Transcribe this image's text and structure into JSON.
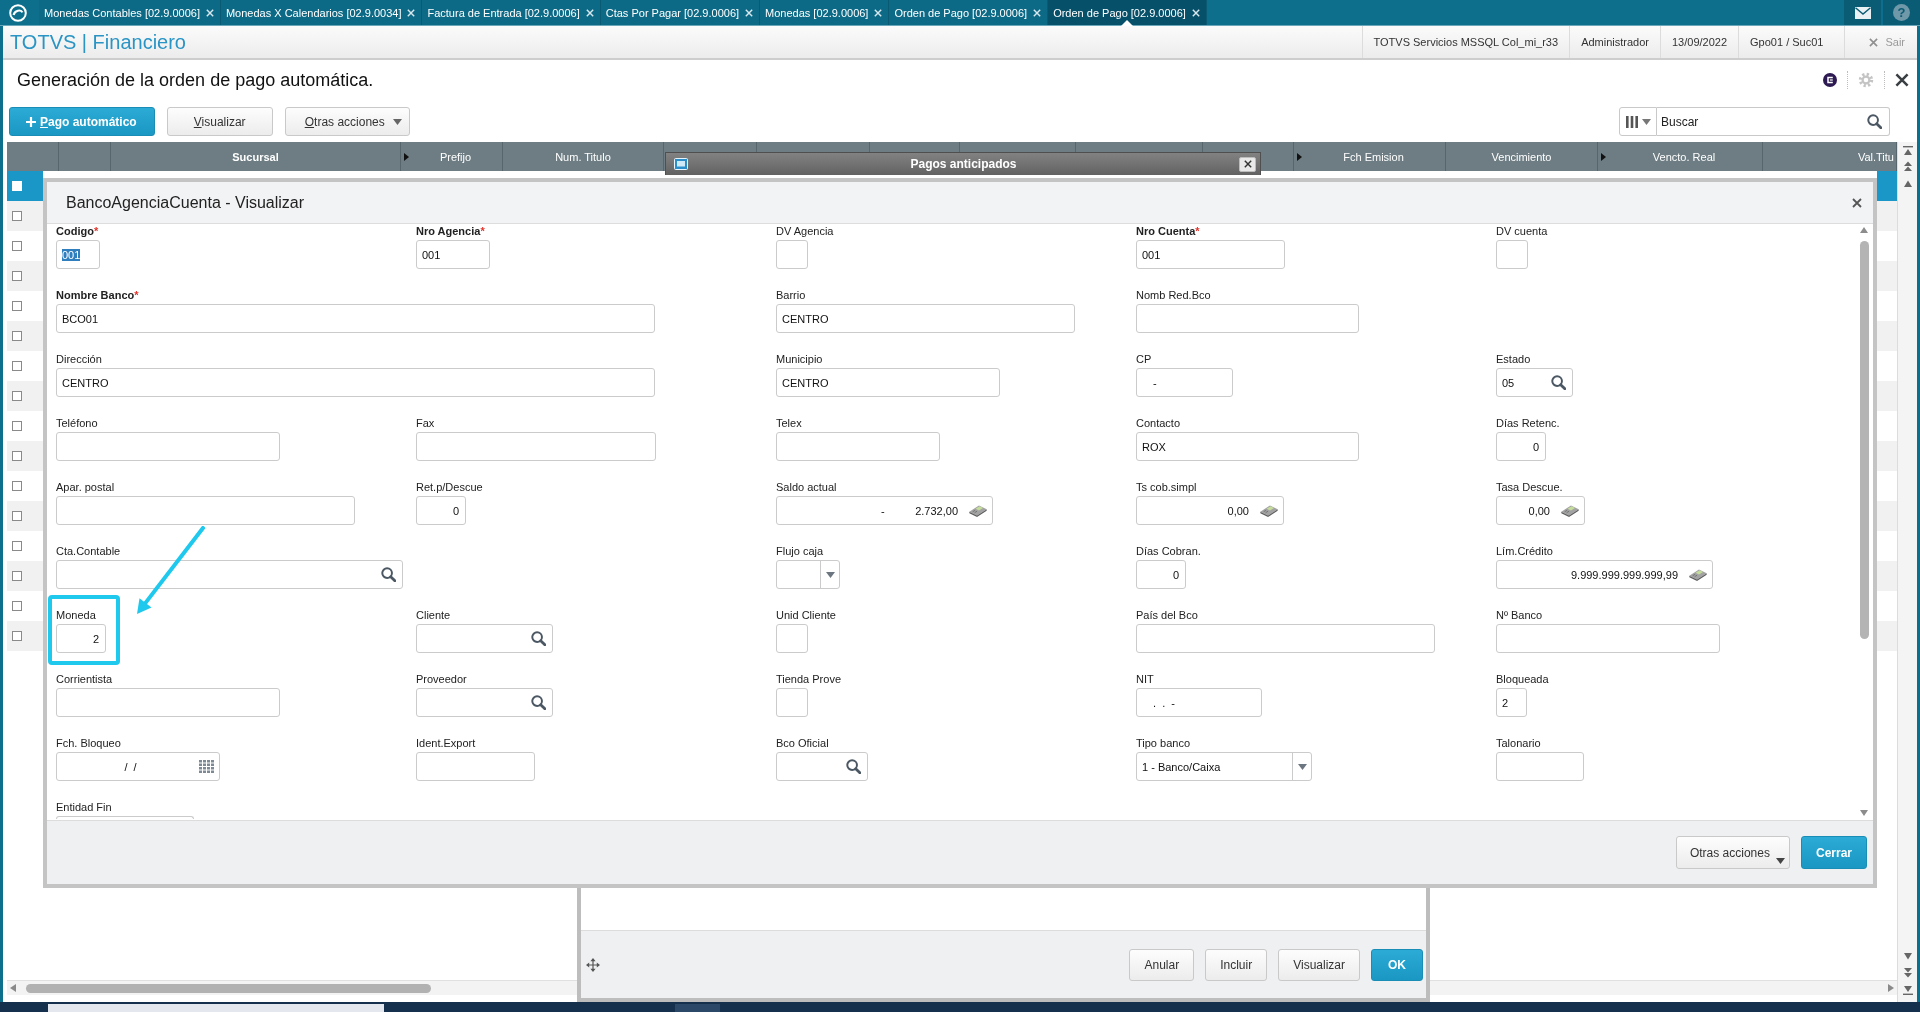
{
  "tab_bar": {
    "tabs": [
      {
        "label": "Monedas Contables [02.9.0006]",
        "selected": false
      },
      {
        "label": "Monedas X Calendarios [02.9.0034]",
        "selected": false
      },
      {
        "label": "Factura de Entrada [02.9.0006]",
        "selected": false
      },
      {
        "label": "Ctas Por Pagar [02.9.0006]",
        "selected": false
      },
      {
        "label": "Monedas [02.9.0006]",
        "selected": false
      },
      {
        "label": "Orden de Pago [02.9.0006]",
        "selected": false
      },
      {
        "label": "Orden de Pago [02.9.0006]",
        "selected": true
      }
    ],
    "help": "?"
  },
  "header": {
    "brand": "TOTVS | Financiero",
    "info": [
      "TOTVS Servicios MSSQL Col_mi_r33",
      "Administrador",
      "13/09/2022",
      "Gpo01 / Suc01"
    ],
    "exit": "Sair"
  },
  "page": {
    "title": "Generación de la orden de pago automática."
  },
  "toolbar": {
    "buttons": [
      {
        "label": "Pago automático",
        "kind": "primary"
      },
      {
        "label": "Visualizar",
        "kind": "plain"
      },
      {
        "label": "Otras acciones",
        "kind": "menu"
      }
    ],
    "search": {
      "placeholder": "Buscar"
    }
  },
  "table": {
    "columns": [
      {
        "label": "Sucursal",
        "marker": false,
        "sorted": true
      },
      {
        "label": "Prefijo",
        "marker": true,
        "sorted": false
      },
      {
        "label": "Num. Titulo",
        "marker": false,
        "sorted": false
      },
      {
        "label": "Fch Emision",
        "marker": true,
        "sorted": false
      },
      {
        "label": "Vencimiento",
        "marker": false,
        "sorted": false
      },
      {
        "label": "Vencto. Real",
        "marker": true,
        "sorted": false
      },
      {
        "label": "Val.Titu",
        "marker": false,
        "sorted": false
      }
    ],
    "rows": [
      {
        "selected": true,
        "checked": false
      },
      {
        "selected": false,
        "checked": false
      },
      {
        "selected": false,
        "checked": false
      },
      {
        "selected": false,
        "checked": false
      },
      {
        "selected": false,
        "checked": false
      },
      {
        "selected": false,
        "checked": false
      },
      {
        "selected": false,
        "checked": false
      },
      {
        "selected": false,
        "checked": false
      },
      {
        "selected": false,
        "checked": false
      },
      {
        "selected": false,
        "checked": false
      },
      {
        "selected": false,
        "checked": false
      },
      {
        "selected": false,
        "checked": false
      },
      {
        "selected": false,
        "checked": false
      },
      {
        "selected": false,
        "checked": false
      },
      {
        "selected": false,
        "checked": false
      },
      {
        "selected": false,
        "checked": false
      }
    ]
  },
  "background_dialog": {
    "title": "Pagos anticipados",
    "buttons": [
      {
        "label": "Anular",
        "kind": "plain"
      },
      {
        "label": "Incluir",
        "kind": "plain"
      },
      {
        "label": "Visualizar",
        "kind": "plain"
      },
      {
        "label": "OK",
        "kind": "primary"
      }
    ]
  },
  "dialog": {
    "title": "BancoAgenciaCuenta - Visualizar",
    "rows": [
      {
        "fields": [
          {
            "label": "Codigo",
            "required": true,
            "required_mark": "*",
            "kind": "text",
            "value": "001",
            "focused": true
          },
          {
            "label": "Nro Agencia",
            "required": true,
            "required_mark": "*",
            "kind": "text",
            "value": "001",
            "focused": false
          },
          {
            "label": "DV Agencia",
            "required": false,
            "kind": "text",
            "focused": false
          },
          {
            "label": "Nro Cuenta",
            "required": true,
            "required_mark": "*",
            "kind": "text",
            "value": "001",
            "focused": false
          },
          {
            "label": "DV cuenta",
            "required": false,
            "kind": "text",
            "focused": false
          }
        ]
      },
      {
        "fields": [
          {
            "label": "Nombre Banco",
            "required": true,
            "required_mark": "*",
            "kind": "text",
            "value": "BCO01",
            "focused": false
          },
          {
            "label": "Barrio",
            "required": false,
            "kind": "text",
            "value": "CENTRO",
            "focused": false
          },
          {
            "label": "Nomb Red.Bco",
            "required": false,
            "kind": "text",
            "focused": false
          }
        ]
      },
      {
        "fields": [
          {
            "label": "Dirección",
            "required": false,
            "kind": "text",
            "value": "CENTRO",
            "focused": false
          },
          {
            "label": "Municipio",
            "required": false,
            "kind": "text",
            "value": "CENTRO",
            "focused": false
          },
          {
            "label": "CP",
            "required": false,
            "kind": "masked",
            "value": "-",
            "focused": false
          },
          {
            "label": "Estado",
            "required": false,
            "kind": "search",
            "value": "05",
            "focused": false
          }
        ]
      },
      {
        "fields": [
          {
            "label": "Teléfono",
            "required": false,
            "kind": "text",
            "focused": false
          },
          {
            "label": "Fax",
            "required": false,
            "kind": "text",
            "focused": false
          },
          {
            "label": "Telex",
            "required": false,
            "kind": "text",
            "focused": false
          },
          {
            "label": "Contacto",
            "required": false,
            "kind": "text",
            "value": "ROX",
            "focused": false
          },
          {
            "label": "Días Retenc.",
            "required": false,
            "kind": "number",
            "value": "0",
            "focused": false
          }
        ]
      },
      {
        "fields": [
          {
            "label": "Apar. postal",
            "required": false,
            "kind": "text",
            "focused": false
          },
          {
            "label": "Ret.p/Descue",
            "required": false,
            "kind": "number",
            "value": "0",
            "focused": false
          },
          {
            "label": "Saldo actual",
            "required": false,
            "kind": "money",
            "value": "-          2.732,00",
            "focused": false
          },
          {
            "label": "Ts cob.simpl",
            "required": false,
            "kind": "money",
            "value": "0,00",
            "focused": false
          },
          {
            "label": "Tasa Descue.",
            "required": false,
            "kind": "money",
            "value": "0,00",
            "focused": false
          }
        ]
      },
      {
        "fields": [
          {
            "label": "Cta.Contable",
            "required": false,
            "kind": "search",
            "focused": false
          },
          {
            "label": "Flujo caja",
            "required": false,
            "kind": "select",
            "focused": false
          },
          {
            "label": "Días Cobran.",
            "required": false,
            "kind": "number",
            "value": "0",
            "focused": false
          },
          {
            "label": "Lím.Crédito",
            "required": false,
            "kind": "money",
            "value": "9.999.999.999.999,99",
            "focused": false
          }
        ]
      },
      {
        "fields": [
          {
            "label": "Moneda",
            "required": false,
            "kind": "number",
            "value": "2",
            "focused": false
          },
          {
            "label": "Cliente",
            "required": false,
            "kind": "search",
            "focused": false
          },
          {
            "label": "Unid Cliente",
            "required": false,
            "kind": "text",
            "focused": false
          },
          {
            "label": "País del Bco",
            "required": false,
            "kind": "text",
            "focused": false
          },
          {
            "label": "Nº Banco",
            "required": false,
            "kind": "text",
            "focused": false
          }
        ]
      },
      {
        "fields": [
          {
            "label": "Corrientista",
            "required": false,
            "kind": "text",
            "focused": false
          },
          {
            "label": "Proveedor",
            "required": false,
            "kind": "search",
            "focused": false
          },
          {
            "label": "Tienda Prove",
            "required": false,
            "kind": "text",
            "focused": false
          },
          {
            "label": "NIT",
            "required": false,
            "kind": "masked",
            "value": ".  .  -",
            "focused": false
          },
          {
            "label": "Bloqueada",
            "required": false,
            "kind": "text",
            "value": "2",
            "focused": false
          }
        ]
      },
      {
        "fields": [
          {
            "label": "Fch. Bloqueo",
            "required": false,
            "kind": "date",
            "value": "/  /",
            "focused": false
          },
          {
            "label": "Ident.Export",
            "required": false,
            "kind": "text",
            "focused": false
          },
          {
            "label": "Bco Oficial",
            "required": false,
            "kind": "search",
            "focused": false
          },
          {
            "label": "Tipo banco",
            "required": false,
            "kind": "select",
            "value": "1 - Banco/Caixa",
            "focused": false
          },
          {
            "label": "Talonario",
            "required": false,
            "kind": "text",
            "focused": false
          }
        ]
      },
      {
        "fields": [
          {
            "label": "Entidad Fin",
            "required": false,
            "kind": "text",
            "focused": false
          }
        ]
      }
    ],
    "buttons": [
      {
        "label": "Otras acciones",
        "kind": "menu"
      },
      {
        "label": "Cerrar",
        "kind": "primary"
      }
    ]
  },
  "annotations": [
    {
      "kind": "frame"
    },
    {
      "kind": "arrow"
    }
  ]
}
